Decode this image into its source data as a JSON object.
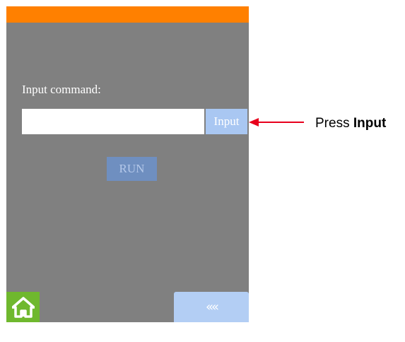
{
  "screen": {
    "prompt_label": "Input command:",
    "command_input": {
      "value": "",
      "placeholder": ""
    },
    "input_button_label": "Input",
    "run_button_label": "RUN",
    "home_icon": "home-icon",
    "back_button_glyph": "««",
    "back_icon": "double-chevron-left-icon"
  },
  "annotation": {
    "prefix": "Press ",
    "emphasis": "Input",
    "arrow_color": "#e8001c"
  },
  "colors": {
    "top_bar": "#ff8000",
    "panel": "#808080",
    "input_button": "#a9c7f2",
    "run_button": "#6f8fc0",
    "home_button": "#6fb82e",
    "back_button": "#b3cef4"
  }
}
